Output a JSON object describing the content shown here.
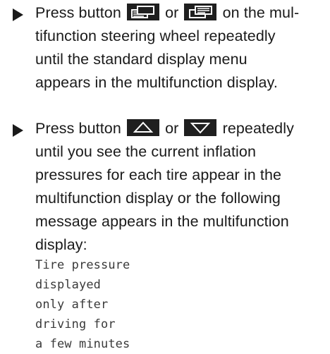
{
  "step1": {
    "pre": "Press button",
    "or": "or",
    "post": "on the mul-",
    "line2": "tifunction steering wheel repeatedly",
    "line3": "until the standard display menu",
    "line4": "appears in the multifunction display.",
    "button_left_icon": "display-page-back-icon",
    "button_right_icon": "display-page-forward-icon"
  },
  "step2": {
    "pre": "Press button",
    "or": "or",
    "post": "repeatedly",
    "line2": "until you see the current inflation",
    "line3": "pressures for each tire appear in the",
    "line4": "multifunction display or the following",
    "line5": "message appears in the multifunction",
    "line6": "display:",
    "button_up_icon": "arrow-up-icon",
    "button_down_icon": "arrow-down-icon",
    "message": [
      "Tire pressure",
      "displayed",
      "only after",
      "driving for",
      "a few minutes"
    ]
  }
}
